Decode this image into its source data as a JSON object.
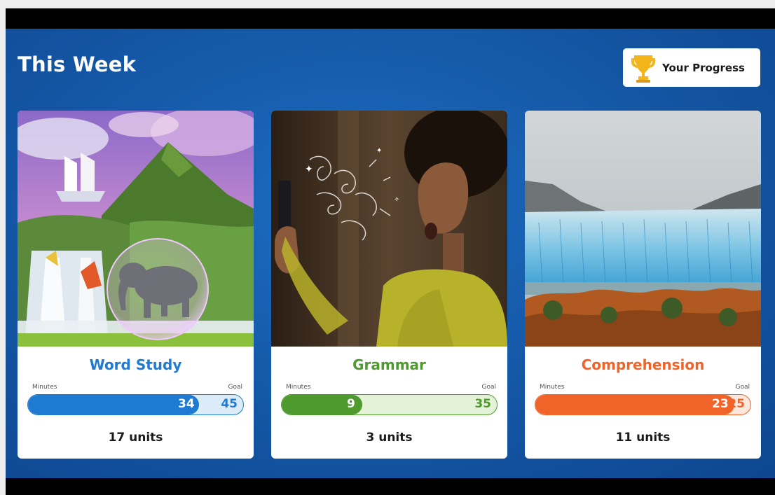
{
  "header": {
    "title": "This Week",
    "progress_button": {
      "label": "Your Progress",
      "icon": "trophy-icon"
    }
  },
  "labels": {
    "minutes": "Minutes",
    "goal": "Goal"
  },
  "cards": [
    {
      "name": "Word Study",
      "minutes": "34",
      "goal": "45",
      "progress": 0.756,
      "units": "17 units",
      "image": "fantasy-landscape-elephant-bubble",
      "color": "#1f7ad1",
      "fill": "#1f7ad1",
      "track": "#dcebf8"
    },
    {
      "name": "Grammar",
      "minutes": "9",
      "goal": "35",
      "progress": 0.257,
      "units": "3 units",
      "image": "woman-surprised-phone",
      "color": "#4e9a2f",
      "fill": "#4e9a2f",
      "track": "#e4f3d8"
    },
    {
      "name": "Comprehension",
      "minutes": "23",
      "goal": "25",
      "progress": 0.92,
      "units": "11 units",
      "image": "glacier-landscape",
      "color": "#f0642a",
      "fill": "#f0642a",
      "track": "#fde6db"
    }
  ]
}
